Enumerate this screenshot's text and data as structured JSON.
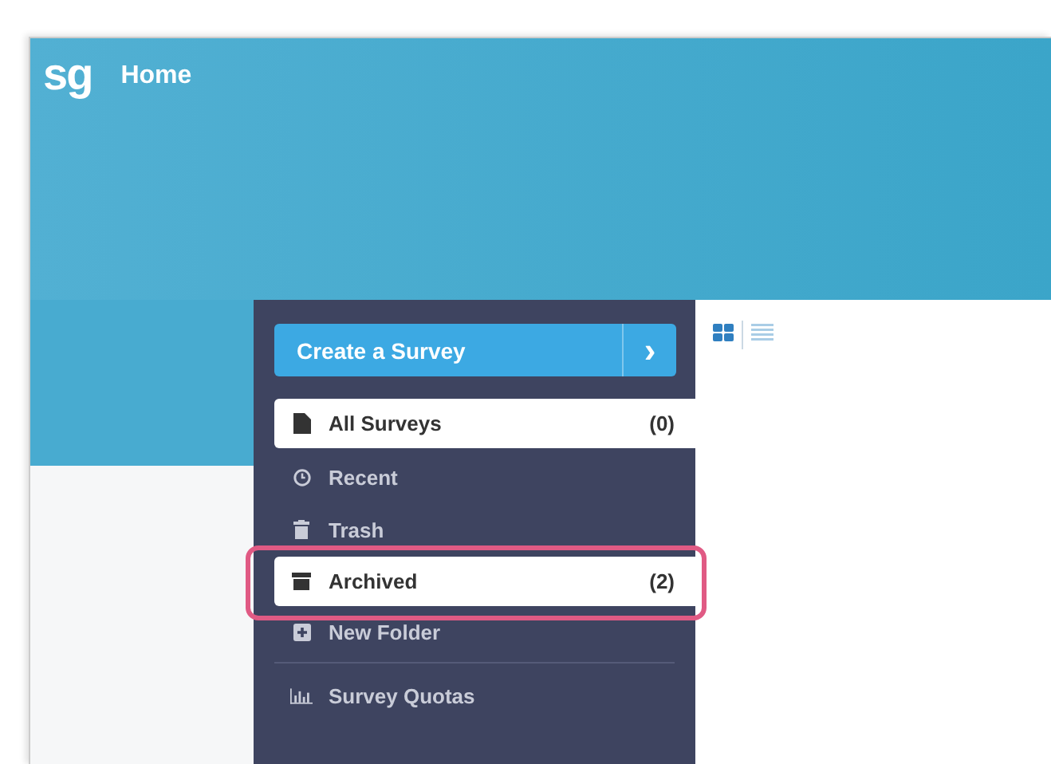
{
  "header": {
    "logo": "sg",
    "title": "Home"
  },
  "sidebar": {
    "create_button": {
      "label": "Create a Survey",
      "arrow": "›"
    },
    "items": [
      {
        "kind": "file",
        "label": "All Surveys",
        "count": "(0)",
        "selected": true,
        "highlighted": false
      },
      {
        "kind": "clock",
        "label": "Recent",
        "selected": false,
        "highlighted": false
      },
      {
        "kind": "trash",
        "label": "Trash",
        "selected": false,
        "highlighted": false
      },
      {
        "kind": "archive",
        "label": "Archived",
        "count": "(2)",
        "selected": true,
        "highlighted": true
      },
      {
        "kind": "plus",
        "label": "New Folder",
        "selected": false,
        "highlighted": false
      },
      {
        "kind": "divider"
      },
      {
        "kind": "chart",
        "label": "Survey Quotas",
        "selected": false,
        "highlighted": false
      }
    ]
  },
  "view_modes": [
    {
      "kind": "grid",
      "selected": true
    },
    {
      "kind": "list",
      "selected": false
    }
  ]
}
